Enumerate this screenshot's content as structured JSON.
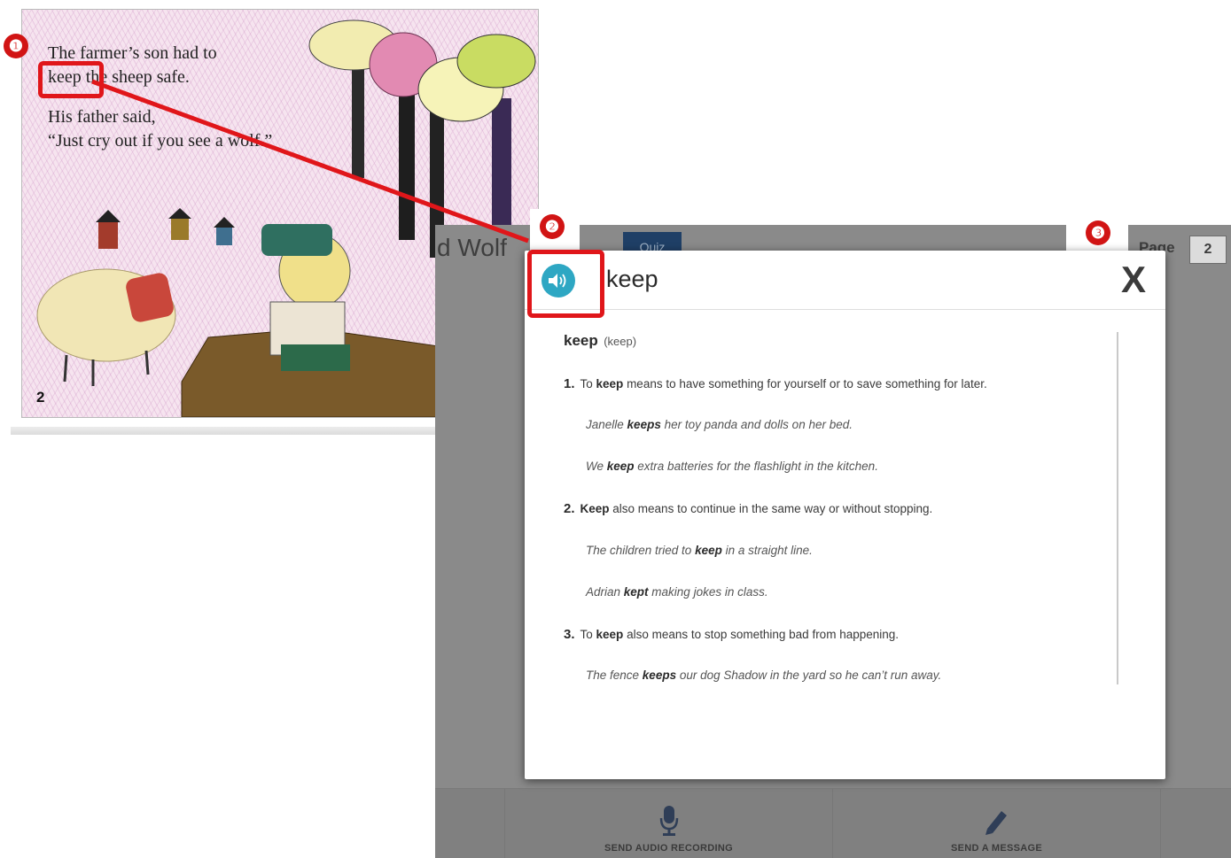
{
  "book": {
    "line1": "The farmer’s son had to",
    "line2": "keep the sheep safe.",
    "line3": "His father said,",
    "line4": "“Just cry out if you see a wolf.”",
    "page_number": "2"
  },
  "markers": [
    "❶",
    "❷",
    "❸"
  ],
  "app": {
    "title_fragment": "d Wolf",
    "quiz_label": "Quiz",
    "page_label": "Page",
    "page_value": "2",
    "send_audio_label": "SEND AUDIO RECORDING",
    "send_message_label": "SEND A MESSAGE"
  },
  "dialog": {
    "word": "keep",
    "close_label": "X",
    "headword": "keep",
    "pronunciation": "(keep)",
    "senses": [
      {
        "number": "1.",
        "pre": "To ",
        "bold": "keep",
        "post": " means to have something for yourself or to save something for later.",
        "examples": [
          {
            "pre": "Janelle ",
            "bold": "keeps",
            "post": " her toy panda and dolls on her bed."
          },
          {
            "pre": "We ",
            "bold": "keep",
            "post": " extra batteries for the flashlight in the kitchen."
          }
        ]
      },
      {
        "number": "2.",
        "pre": "",
        "bold": "Keep",
        "post": " also means to continue in the same way or without stopping.",
        "examples": [
          {
            "pre": "The children tried to ",
            "bold": "keep",
            "post": " in a straight line."
          },
          {
            "pre": "Adrian ",
            "bold": "kept",
            "post": " making jokes in class."
          }
        ]
      },
      {
        "number": "3.",
        "pre": "To ",
        "bold": "keep",
        "post": " also means to stop something bad from happening.",
        "examples": [
          {
            "pre": "The fence ",
            "bold": "keeps",
            "post": " our dog Shadow in the yard so he can’t run away."
          }
        ]
      }
    ]
  },
  "colors": {
    "marker_red": "#d11414",
    "audio_teal": "#2ea7c3",
    "quiz_navy": "#1f3f66",
    "overlay_gray": "#8a8a8a"
  }
}
